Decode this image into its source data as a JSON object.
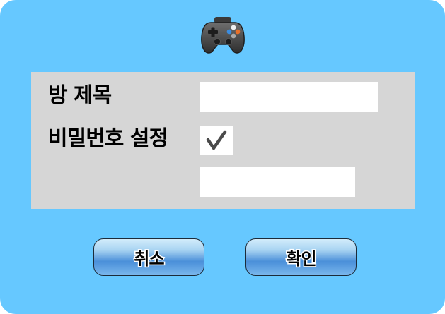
{
  "header": {
    "icon": "game-controller-icon"
  },
  "form": {
    "room_title_label": "방 제목",
    "room_title_value": "",
    "password_setting_label": "비밀번호 설정",
    "password_enabled": true,
    "password_value": ""
  },
  "buttons": {
    "cancel_label": "취소",
    "confirm_label": "확인"
  },
  "colors": {
    "background": "#66c8ff",
    "panel": "#d6d6d6",
    "field": "#ffffff",
    "button_gradient_top": "#d2ecfb",
    "button_gradient_mid": "#4a8fd9"
  }
}
